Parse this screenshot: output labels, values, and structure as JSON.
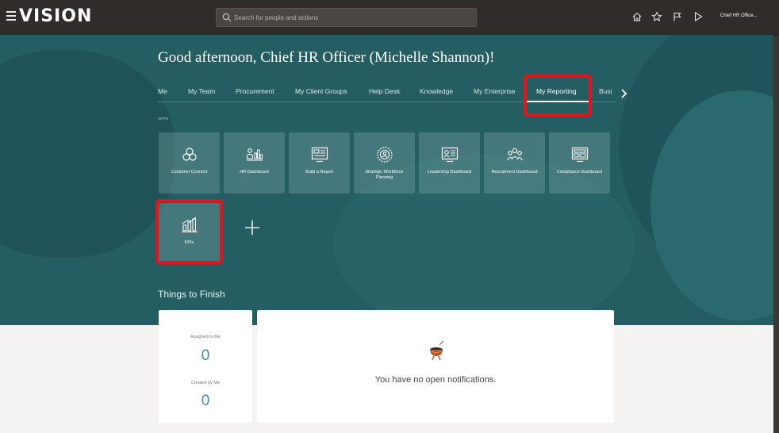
{
  "header": {
    "logo_text": "VISION",
    "search_placeholder": "Search for people and actions",
    "user_menu_label": "Chief HR Office..."
  },
  "greeting": "Good afternoon, Chief HR Officer (Michelle Shannon)!",
  "tabs": [
    {
      "label": "Me"
    },
    {
      "label": "My Team"
    },
    {
      "label": "Procurement"
    },
    {
      "label": "My Client Groups"
    },
    {
      "label": "Help Desk"
    },
    {
      "label": "Knowledge"
    },
    {
      "label": "My Enterprise"
    },
    {
      "label": "My Reporting",
      "active": true
    },
    {
      "label": "Busi"
    }
  ],
  "apps_label": "APPS",
  "apps": [
    {
      "label": "Customer Connect",
      "icon": "three-circles-icon"
    },
    {
      "label": "HR Dashboard",
      "icon": "people-chart-icon"
    },
    {
      "label": "Build a Report",
      "icon": "report-screen-icon"
    },
    {
      "label": "Strategic Workforce Planning",
      "icon": "gear-badge-icon"
    },
    {
      "label": "Leadership Dashboard",
      "icon": "dashboard-screen-icon"
    },
    {
      "label": "Recruitment Dashboard",
      "icon": "people-group-icon"
    },
    {
      "label": "Compliance Dashboard",
      "icon": "compliance-screen-icon"
    },
    {
      "label": "KPIs",
      "icon": "bar-chart-icon"
    }
  ],
  "things_to_finish": {
    "title": "Things to Finish",
    "assigned_label": "Assigned to Me",
    "assigned_count": "0",
    "created_label": "Created by Me",
    "created_count": "0",
    "empty_message": "You have no open notifications."
  },
  "colors": {
    "topbar": "#302c29",
    "hero": "#245e63",
    "highlight": "#e2141c",
    "count": "#3c8fb4"
  }
}
